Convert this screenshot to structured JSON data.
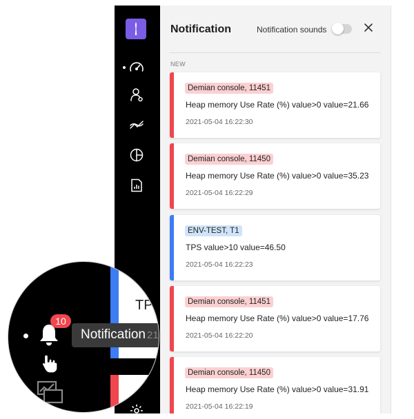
{
  "icons": {
    "logo": "app-logo-icon",
    "nav": [
      "dashboard-gauge-icon",
      "users-icon",
      "trend-icon",
      "pie-chart-icon",
      "report-icon",
      "settings-icon"
    ],
    "close": "close-icon",
    "bell": "bell-icon"
  },
  "colors": {
    "sidebar": "#000000",
    "accent": "#7a5ce6",
    "alert_red": "#f0464e",
    "info_blue": "#3d7cf2"
  },
  "panel": {
    "title": "Notification",
    "sound_label": "Notification sounds",
    "sound_enabled": false,
    "section_label": "NEW"
  },
  "notifications": [
    {
      "level": "red",
      "tag": "Demian console, 11451",
      "message": "Heap memory Use Rate (%) value>0 value=21.66",
      "time": "2021-05-04 16:22:30"
    },
    {
      "level": "red",
      "tag": "Demian console, 11450",
      "message": "Heap memory Use Rate (%) value>0 value=35.23",
      "time": "2021-05-04 16:22:29"
    },
    {
      "level": "blue",
      "tag": "ENV-TEST, T1",
      "message": "TPS value>10 value=46.50",
      "time": "2021-05-04 16:22:23"
    },
    {
      "level": "red",
      "tag": "Demian console, 11451",
      "message": "Heap memory Use Rate (%) value>0 value=17.76",
      "time": "2021-05-04 16:22:20"
    },
    {
      "level": "red",
      "tag": "Demian console, 11450",
      "message": "Heap memory Use Rate (%) value>0 value=31.91",
      "time": "2021-05-04 16:22:19"
    }
  ],
  "magnifier": {
    "badge_count": "10",
    "tooltip": "Notification",
    "tooltip_suffix": "21",
    "partial_card_text": "TPS"
  }
}
